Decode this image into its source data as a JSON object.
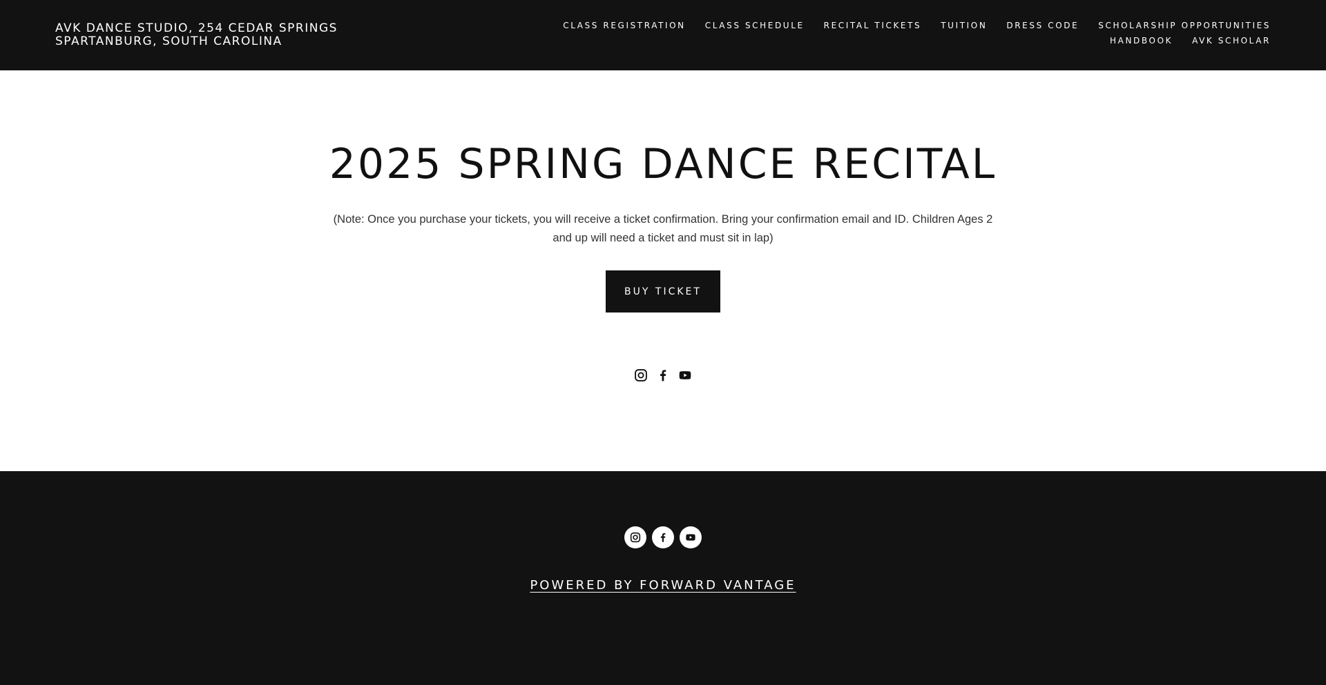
{
  "header": {
    "brand": "AVK DANCE STUDIO, 254 CEDAR SPRINGS SPARTANBURG, SOUTH CAROLINA",
    "nav": [
      {
        "label": "CLASS REGISTRATION"
      },
      {
        "label": "CLASS SCHEDULE"
      },
      {
        "label": "RECITAL TICKETS"
      },
      {
        "label": "TUITION"
      },
      {
        "label": "DRESS CODE"
      },
      {
        "label": "SCHOLARSHIP OPPORTUNITIES"
      },
      {
        "label": "HANDBOOK"
      },
      {
        "label": "AVK SCHOLAR"
      }
    ]
  },
  "main": {
    "title": "2025 SPRING DANCE RECITAL",
    "note": "(Note: Once you purchase your tickets, you will receive a ticket confirmation. Bring your confirmation email and ID. Children Ages 2 and up will need a ticket and must sit in lap)",
    "button_label": "BUY TICKET",
    "social_icons": [
      "instagram-icon",
      "facebook-icon",
      "youtube-icon"
    ]
  },
  "footer": {
    "social_icons": [
      "instagram-icon",
      "facebook-icon",
      "youtube-icon"
    ],
    "powered_by": "POWERED BY FORWARD VANTAGE"
  },
  "colors": {
    "dark": "#121212",
    "light": "#ffffff",
    "text": "#111111"
  }
}
